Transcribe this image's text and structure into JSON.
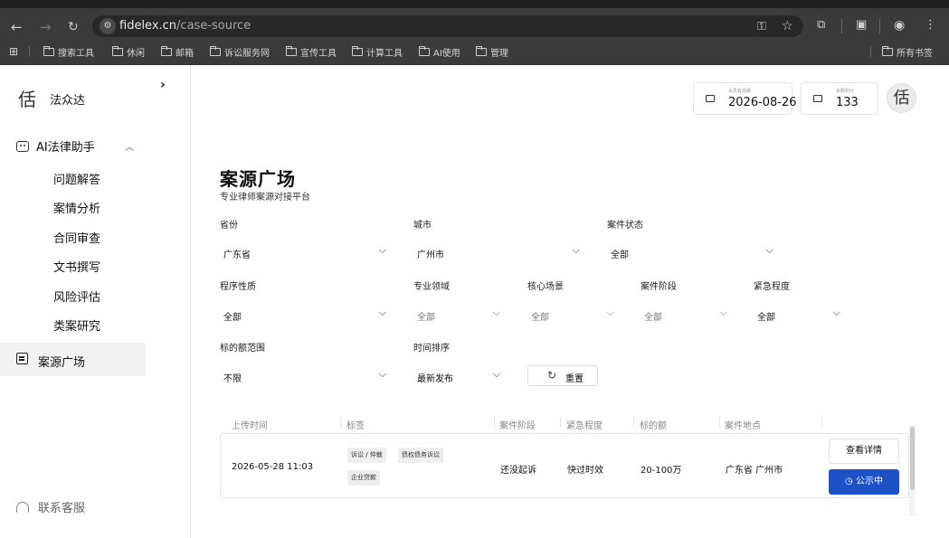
{
  "browser": {
    "url_domain": "fidelex.cn",
    "url_path": "/case-source",
    "bookmarks": [
      "搜索工具",
      "休闲",
      "邮箱",
      "诉讼服务网",
      "宣传工具",
      "计算工具",
      "AI使用",
      "管理"
    ],
    "all_bookmarks": "所有书签"
  },
  "brand": {
    "name": "法众达",
    "logo_glyph": "佸"
  },
  "sidebar": {
    "group_label": "AI法律助手",
    "items": [
      "问题解答",
      "案情分析",
      "合同审查",
      "文书撰写",
      "风险评估",
      "类案研究"
    ],
    "active_label": "案源广场",
    "support_label": "联系客服"
  },
  "header": {
    "membership_caption": "会员有效期",
    "membership_date": "2026-08-26",
    "points_caption": "余额积分",
    "points_value": "133"
  },
  "page": {
    "title": "案源广场",
    "subtitle": "专业律师案源对接平台"
  },
  "filters": {
    "province": {
      "label": "省份",
      "value": "广东省"
    },
    "city": {
      "label": "城市",
      "value": "广州市"
    },
    "case_status": {
      "label": "案件状态",
      "value": "全部"
    },
    "procedure": {
      "label": "程序性质",
      "value": "全部"
    },
    "field": {
      "label": "专业领域",
      "value": "全部"
    },
    "scenario": {
      "label": "核心场景",
      "value": "全部"
    },
    "stage": {
      "label": "案件阶段",
      "value": "全部"
    },
    "urgency": {
      "label": "紧急程度",
      "value": "全部"
    },
    "amount": {
      "label": "标的额范围",
      "value": "不限"
    },
    "sort": {
      "label": "时间排序",
      "value": "最新发布"
    },
    "reset_label": "重置"
  },
  "table": {
    "headers": [
      "上传时间",
      "标签",
      "案件阶段",
      "紧急程度",
      "标的额",
      "案件地点"
    ],
    "rows": [
      {
        "upload_time": "2026-05-28 11:03",
        "tags": [
          "诉讼 / 仲裁",
          "债权债务诉讼",
          "企业贷款"
        ],
        "stage": "还没起诉",
        "urgency": "快过时效",
        "amount": "20-100万",
        "location": "广东省 广州市",
        "detail_label": "查看详情",
        "status_label": "公示中"
      }
    ]
  },
  "colors": {
    "accent": "#1d51c8",
    "active_bg": "#f2f2f2"
  }
}
